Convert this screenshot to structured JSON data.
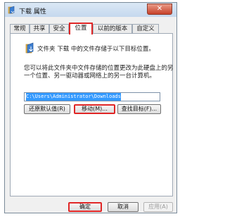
{
  "window": {
    "title": "下载 属性",
    "close_glyph": "✕"
  },
  "tabs": [
    {
      "label": "常规"
    },
    {
      "label": "共享"
    },
    {
      "label": "安全"
    },
    {
      "label": "位置"
    },
    {
      "label": "以前的版本"
    },
    {
      "label": "自定义"
    }
  ],
  "location": {
    "description": "文件夹 下载 中的文件存储于以下目标位置。",
    "details": "您可以将此文件夹中文件存储的位置更改为此硬盘上的另一个位置、另一驱动器或网络上的另一台计算机。",
    "path": "C:\\Users\\Administrator\\Downloads",
    "restore_default_label": "还原默认值(R)",
    "move_label": "移动(M)...",
    "find_target_label": "查找目标(F)..."
  },
  "footer": {
    "ok_label": "确定",
    "cancel_label": "取消",
    "apply_label": "应用(A)"
  },
  "icons": {
    "title": "folder-icon",
    "content": "folder-icon"
  },
  "colors": {
    "highlight": "#e02626",
    "selection": "#3399ff"
  }
}
